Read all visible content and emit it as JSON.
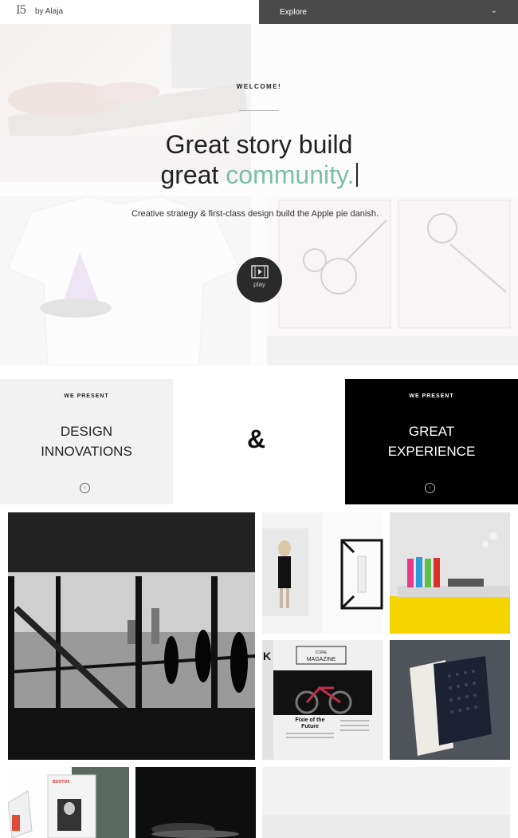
{
  "brand": {
    "logo": "I5",
    "byline": "by Alaja"
  },
  "nav": {
    "explore_label": "Explore"
  },
  "hero": {
    "welcome": "WELCOME!",
    "headline_line1": "Great story build",
    "headline_line2_prefix": "great",
    "headline_line2_accent": "community.",
    "tagline": "Creative strategy & first-class design build the Apple pie danish.",
    "play_label": "play"
  },
  "present": {
    "left": {
      "kicker": "WE PRESENT",
      "line1": "DESIGN",
      "line2": "INNOVATIONS"
    },
    "ampersand": "&",
    "right": {
      "kicker": "WE PRESENT",
      "line1": "GREAT",
      "line2": "EXPERIENCE"
    }
  },
  "gallery": {
    "magazine": {
      "kicker": "CORE",
      "title": "MAGAZINE",
      "headline_1": "Fixie of the",
      "headline_2": "Future"
    },
    "brochure_label": "BOOTOX"
  },
  "colors": {
    "accent": "#7bbfa9",
    "explore_bg": "#4a4a4a",
    "dark_block": "#000000",
    "light_block": "#f2f2f2",
    "marker_shelf": "#f5d400"
  }
}
